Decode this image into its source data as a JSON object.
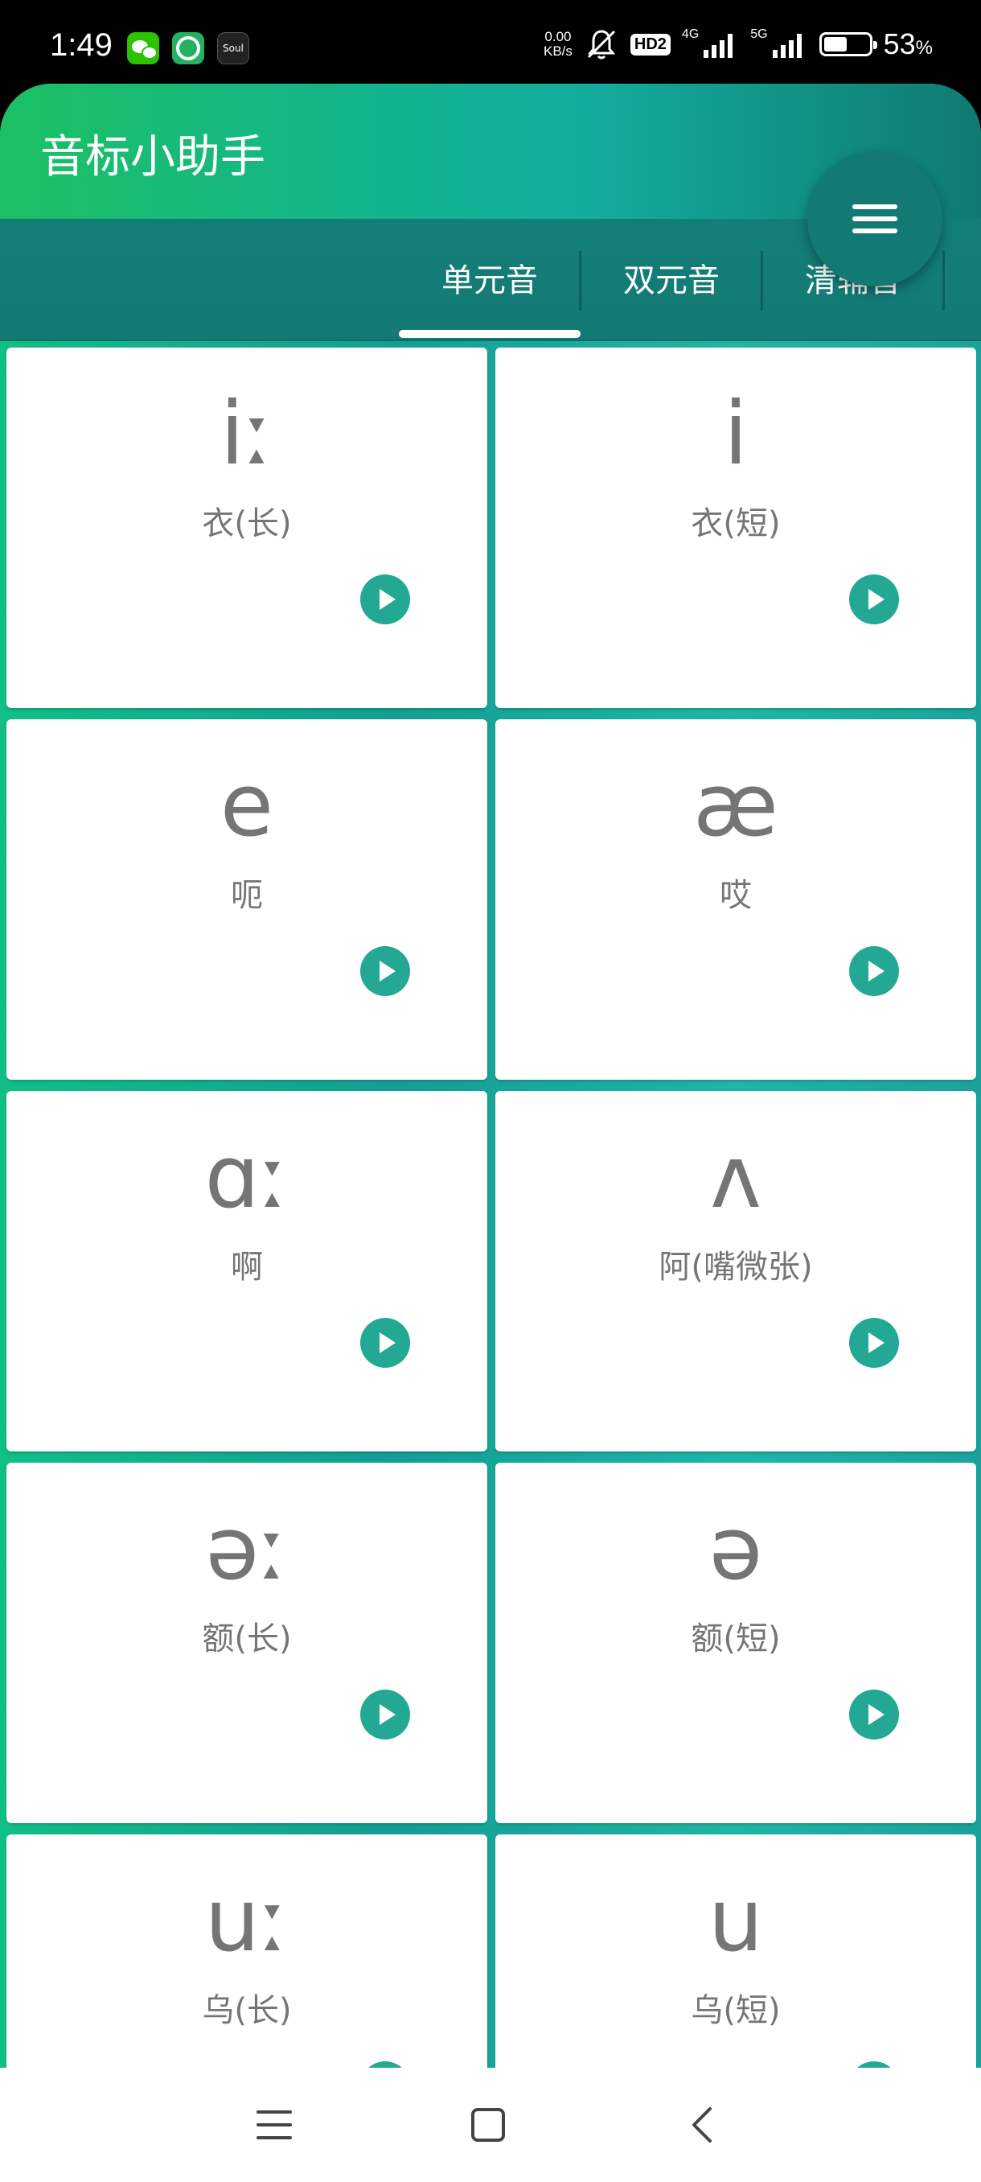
{
  "status_bar": {
    "time": "1:49",
    "net_speed_value": "0.00",
    "net_speed_unit": "KB/s",
    "hd_label": "HD2",
    "sim1_label": "4G",
    "sim2_label": "5G",
    "battery_percent": "53",
    "battery_percent_sign": "%",
    "battery_level": 0.53,
    "app_icons": [
      "wechat-icon",
      "browser-icon",
      "soul-icon"
    ],
    "soul_label": "Soul"
  },
  "app": {
    "title": "音标小助手",
    "tabs": [
      {
        "label": "单元音",
        "active": true
      },
      {
        "label": "双元音",
        "active": false
      },
      {
        "label": "清辅音",
        "active": false
      }
    ],
    "menu_icon": "hamburger-menu-icon",
    "accent_color": "#23a893"
  },
  "cards": [
    {
      "symbol": "iː",
      "hint": "衣(长)"
    },
    {
      "symbol": "i",
      "hint": "衣(短)"
    },
    {
      "symbol": "e",
      "hint": "呃"
    },
    {
      "symbol": "æ",
      "hint": "哎"
    },
    {
      "symbol": "ɑː",
      "hint": "啊"
    },
    {
      "symbol": "ʌ",
      "hint": "阿(嘴微张)"
    },
    {
      "symbol": "əː",
      "hint": "额(长)"
    },
    {
      "symbol": "ə",
      "hint": "额(短)"
    },
    {
      "symbol": "uː",
      "hint": "乌(长)"
    },
    {
      "symbol": "u",
      "hint": "乌(短)"
    }
  ],
  "nav_bar": {
    "buttons": [
      "menu-icon",
      "home-icon",
      "back-icon"
    ]
  }
}
